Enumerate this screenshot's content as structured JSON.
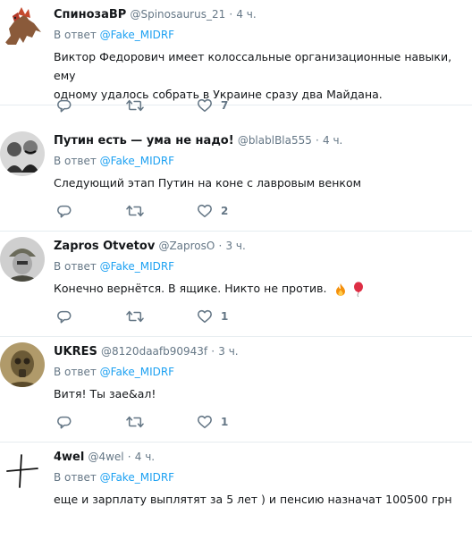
{
  "tweets": [
    {
      "name": "СпинозаВР",
      "handle": "@Spinosaurus_21",
      "dot": "·",
      "time": "4 ч.",
      "reply_prefix": "В ответ",
      "reply_to": "@Fake_MIDRF",
      "text_line1": "Виктор Федорович имеет колоссальные организационные навыки, ему",
      "text_line2": "одному удалось собрать в Украине сразу два Майдана.",
      "likes": "7"
    },
    {
      "name": "Путин есть — ума не надо!",
      "handle": "@blablBla555",
      "dot": "·",
      "time": "4 ч.",
      "reply_prefix": "В ответ",
      "reply_to": "@Fake_MIDRF",
      "text_line1": "Следующий этап Путин на коне с лавровым венком",
      "likes": "2"
    },
    {
      "name": "Zapros Otvetov",
      "handle": "@ZaprosO",
      "dot": "·",
      "time": "3 ч.",
      "reply_prefix": "В ответ",
      "reply_to": "@Fake_MIDRF",
      "text_line1": "Конечно вернётся. В ящике. Никто не против.",
      "likes": "1"
    },
    {
      "name": "UKRES",
      "handle": "@8120daafb90943f",
      "dot": "·",
      "time": "3 ч.",
      "reply_prefix": "В ответ",
      "reply_to": "@Fake_MIDRF",
      "text_line1": "Витя! Ты зае&ал!",
      "likes": "1"
    },
    {
      "name": "4wel",
      "handle": "@4wel",
      "dot": "·",
      "time": "4 ч.",
      "reply_prefix": "В ответ",
      "reply_to": "@Fake_MIDRF",
      "text_line1": "еще и зарплату выплятят за 5 лет ) и пенсию назначат 100500 грн"
    }
  ],
  "colors": {
    "accent": "#1da1f2",
    "secondary": "#657786",
    "text": "#14171a",
    "divider": "#e6ecf0"
  },
  "icons": {
    "reply": "reply-icon",
    "retweet": "retweet-icon",
    "like": "heart-icon",
    "fire": "fire-emoji-icon",
    "balloon": "balloon-emoji-icon"
  }
}
